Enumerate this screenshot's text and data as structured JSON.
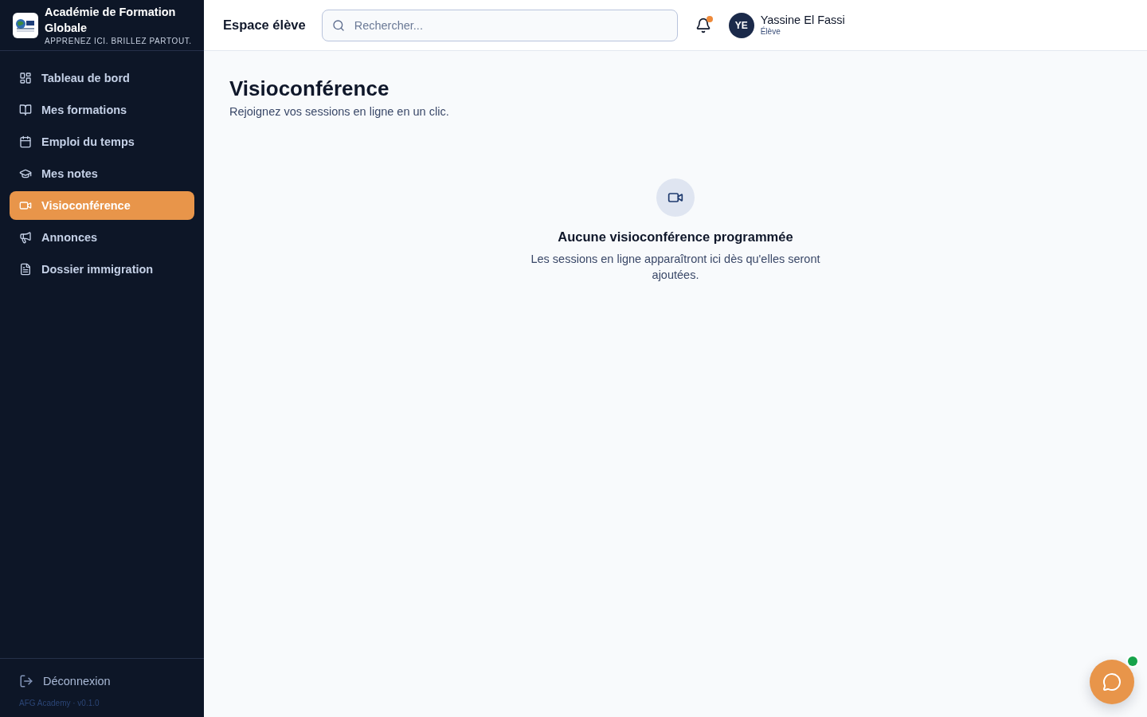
{
  "sidebar": {
    "brand": {
      "name": "Académie de Formation Globale",
      "tagline": "APPRENEZ ICI. BRILLEZ PARTOUT."
    },
    "nav_items": [
      {
        "label": "Tableau de bord",
        "selected": false
      },
      {
        "label": "Mes formations",
        "selected": false
      },
      {
        "label": "Emploi du temps",
        "selected": false
      },
      {
        "label": "Mes notes",
        "selected": false
      },
      {
        "label": "Visioconférence",
        "selected": true
      },
      {
        "label": "Annonces",
        "selected": false
      },
      {
        "label": "Dossier immigration",
        "selected": false
      }
    ],
    "logout": {
      "label": "Déconnexion"
    },
    "version": "AFG Academy · v0.1.0"
  },
  "header": {
    "title": "Espace élève",
    "search": {
      "placeholder": "Rechercher..."
    },
    "notifications": {
      "unread": true
    },
    "user": {
      "initials": "YE",
      "name": "Yassine El Fassi",
      "role": "Élève"
    }
  },
  "page": {
    "title": "Visioconférence",
    "subtitle": "Rejoignez vos sessions en ligne en un clic."
  },
  "empty_state": {
    "title": "Aucune visioconférence programmée",
    "message": "Les sessions en ligne apparaîtront ici dès qu'elles seront ajoutées."
  },
  "chat_button": {
    "online": true
  }
}
